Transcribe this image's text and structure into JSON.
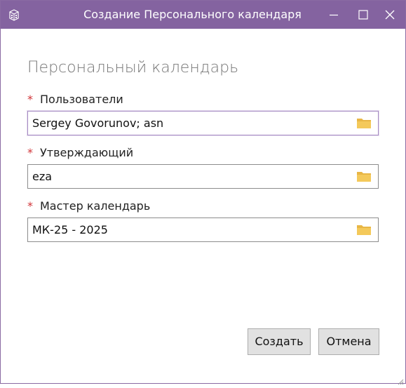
{
  "window": {
    "title": "Создание Персонального календаря"
  },
  "form": {
    "heading": "Персональный календарь",
    "required_mark": "*",
    "fields": [
      {
        "label": "Пользователи",
        "value": "Sergey Govorunov; asn",
        "focused": true
      },
      {
        "label": "Утверждающий",
        "value": "eza",
        "focused": false
      },
      {
        "label": "Мастер календарь",
        "value": "МК-25 - 2025",
        "focused": false
      }
    ]
  },
  "buttons": {
    "create_label": "Создать",
    "cancel_label": "Отмена"
  },
  "colors": {
    "titlebar": "#8463a0",
    "required": "#d13438",
    "folder": "#f0c24f"
  },
  "icons": {
    "app": "calendar-app-icon",
    "field_browse": "folder-icon",
    "minimize": "minimize-icon",
    "maximize": "maximize-icon",
    "close": "close-icon",
    "resize": "resize-grip-icon"
  }
}
